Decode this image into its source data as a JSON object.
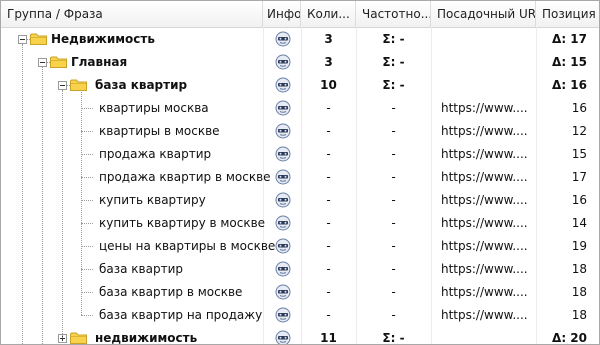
{
  "columns": {
    "phrase": "Группа / Фраза",
    "info": "Инфо",
    "count": "Коли...",
    "freq": "Частотно...",
    "url": "Посадочный URL",
    "position": "Позиция"
  },
  "rows": [
    {
      "name": "Недвижимость",
      "type": "group",
      "expanded": true,
      "count": "3",
      "freq": "Σ: -",
      "url": "",
      "pos": "Δ: 17"
    },
    {
      "name": "Главная",
      "type": "group",
      "expanded": true,
      "count": "3",
      "freq": "Σ: -",
      "url": "",
      "pos": "Δ: 15"
    },
    {
      "name": "база квартир",
      "type": "group",
      "expanded": true,
      "count": "10",
      "freq": "Σ: -",
      "url": "",
      "pos": "Δ: 16"
    },
    {
      "name": "квартиры москва",
      "type": "phrase",
      "count": "-",
      "freq": "-",
      "url": "https://www....",
      "pos": "16"
    },
    {
      "name": "квартиры в москве",
      "type": "phrase",
      "count": "-",
      "freq": "-",
      "url": "https://www....",
      "pos": "12"
    },
    {
      "name": "продажа квартир",
      "type": "phrase",
      "count": "-",
      "freq": "-",
      "url": "https://www....",
      "pos": "15"
    },
    {
      "name": "продажа квартир в москве",
      "type": "phrase",
      "count": "-",
      "freq": "-",
      "url": "https://www....",
      "pos": "17"
    },
    {
      "name": "купить квартиру",
      "type": "phrase",
      "count": "-",
      "freq": "-",
      "url": "https://www....",
      "pos": "16"
    },
    {
      "name": "купить квартиру в москве",
      "type": "phrase",
      "count": "-",
      "freq": "-",
      "url": "https://www....",
      "pos": "14"
    },
    {
      "name": "цены на квартиры в москве",
      "type": "phrase",
      "count": "-",
      "freq": "-",
      "url": "https://www....",
      "pos": "19"
    },
    {
      "name": "база квартир",
      "type": "phrase",
      "count": "-",
      "freq": "-",
      "url": "https://www....",
      "pos": "18"
    },
    {
      "name": "база квартир в москве",
      "type": "phrase",
      "count": "-",
      "freq": "-",
      "url": "https://www....",
      "pos": "18"
    },
    {
      "name": "база квартир на продажу",
      "type": "phrase",
      "count": "-",
      "freq": "-",
      "url": "https://www....",
      "pos": "18"
    },
    {
      "name": "недвижимость",
      "type": "group",
      "expanded": false,
      "count": "11",
      "freq": "Σ: -",
      "url": "",
      "pos": "Δ: 20"
    }
  ],
  "colors": {
    "folder": "#f7d24a",
    "folder_edge": "#c9a227",
    "info_icon": "#6a7fa6"
  },
  "icons": {
    "folder": "folder-icon",
    "info": "info-icon",
    "expand": "expand-toggle-icon"
  }
}
